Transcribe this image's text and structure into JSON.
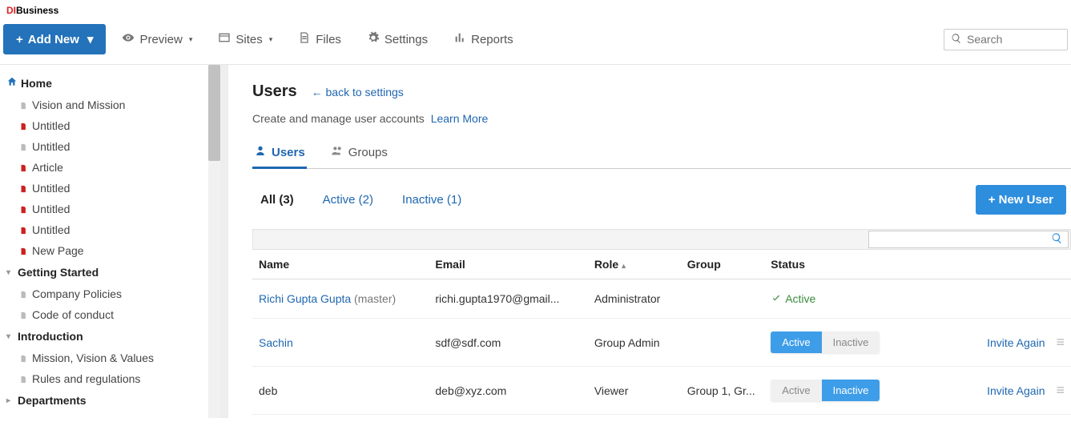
{
  "brand": {
    "prefix": "DI",
    "suffix": "Business"
  },
  "toolbar": {
    "add_new": "Add New",
    "preview": "Preview",
    "sites": "Sites",
    "files": "Files",
    "settings": "Settings",
    "reports": "Reports",
    "search_placeholder": "Search"
  },
  "sidebar": {
    "home": {
      "label": "Home",
      "items": [
        {
          "label": "Vision and Mission",
          "color": "gray"
        },
        {
          "label": "Untitled",
          "color": "red"
        },
        {
          "label": "Untitled",
          "color": "gray"
        },
        {
          "label": "Article",
          "color": "red"
        },
        {
          "label": "Untitled",
          "color": "red"
        },
        {
          "label": "Untitled",
          "color": "red"
        },
        {
          "label": "Untitled",
          "color": "red"
        },
        {
          "label": "New Page",
          "color": "red"
        }
      ]
    },
    "getting_started": {
      "label": "Getting Started",
      "items": [
        {
          "label": "Company Policies",
          "color": "gray"
        },
        {
          "label": "Code of conduct",
          "color": "gray"
        }
      ]
    },
    "introduction": {
      "label": "Introduction",
      "items": [
        {
          "label": "Mission, Vision & Values",
          "color": "gray"
        },
        {
          "label": "Rules and regulations",
          "color": "gray"
        }
      ]
    },
    "departments": {
      "label": "Departments"
    }
  },
  "page": {
    "title": "Users",
    "back": "← back to settings",
    "subtitle": "Create and manage user accounts",
    "learn_more": "Learn More"
  },
  "tabs": {
    "users": "Users",
    "groups": "Groups"
  },
  "filters": {
    "all": "All (3)",
    "active": "Active (2)",
    "inactive": "Inactive (1)"
  },
  "new_user_btn": "+ New User",
  "table": {
    "headers": {
      "name": "Name",
      "email": "Email",
      "role": "Role",
      "group": "Group",
      "status": "Status"
    },
    "rows": [
      {
        "name": "Richi Gupta Gupta",
        "name_suffix": " (master)",
        "email": "richi.gupta1970@gmail...",
        "role": "Administrator",
        "group": "",
        "status_text": "Active",
        "status_mode": "label"
      },
      {
        "name": "Sachin",
        "name_suffix": "",
        "email": "sdf@sdf.com",
        "role": "Group Admin",
        "group": "",
        "status_mode": "toggle",
        "toggle_active_on": true,
        "invite": "Invite Again"
      },
      {
        "name": "deb",
        "name_suffix": "",
        "email": "deb@xyz.com",
        "role": "Viewer",
        "group": "Group 1, Gr...",
        "status_mode": "toggle",
        "toggle_active_on": false,
        "invite": "Invite Again"
      }
    ],
    "toggle_labels": {
      "active": "Active",
      "inactive": "Inactive"
    }
  }
}
